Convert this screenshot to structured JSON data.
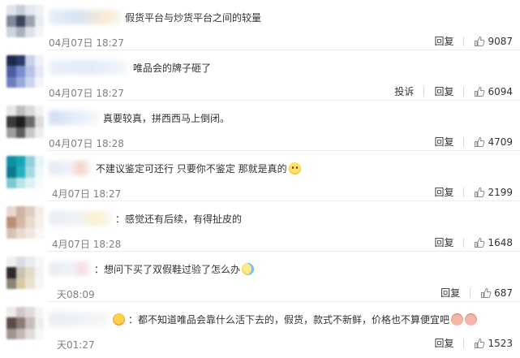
{
  "comments": [
    {
      "text": "假货平台与炒货平台之间的较量",
      "time": "04月07日 18:27",
      "actions": [
        "回复"
      ],
      "likes": "9087",
      "emojis": []
    },
    {
      "text": "唯品会的牌子砸了",
      "time": "04月07日 18:27",
      "actions": [
        "投诉",
        "回复"
      ],
      "likes": "6094",
      "emojis": []
    },
    {
      "text": "真要较真，拼西西马上倒闭。",
      "time": "04月07日 18:28",
      "actions": [
        "回复"
      ],
      "likes": "4709",
      "emojis": []
    },
    {
      "text": "不建议鉴定可还行 只要你不鉴定 那就是真的",
      "time": "4月07日 18:27",
      "actions": [
        "回复"
      ],
      "likes": "2199",
      "emojis": [
        "face-icon"
      ]
    },
    {
      "text": "：感觉还有后续，有得扯皮的",
      "time": "4月07日 18:28",
      "actions": [
        "回复"
      ],
      "likes": "1648",
      "emojis": []
    },
    {
      "text": "：想问下买了双假鞋过验了怎么办",
      "time": "天08:09",
      "actions": [
        "回复"
      ],
      "likes": "687",
      "emojis": [
        "crying-laughing-icon"
      ]
    },
    {
      "text": "：都不知道唯品会靠什么活下去的，假货，款式不新鲜，价格也不算便宜吧",
      "time": "天01:27",
      "actions": [
        "回复"
      ],
      "likes": "1523",
      "emojis": [
        "pig-icon",
        "pig-icon"
      ],
      "prefix_emoji": "flushed-icon"
    }
  ],
  "colors": {
    "text": "#333333",
    "time": "#808080",
    "divider": "#ececec"
  }
}
